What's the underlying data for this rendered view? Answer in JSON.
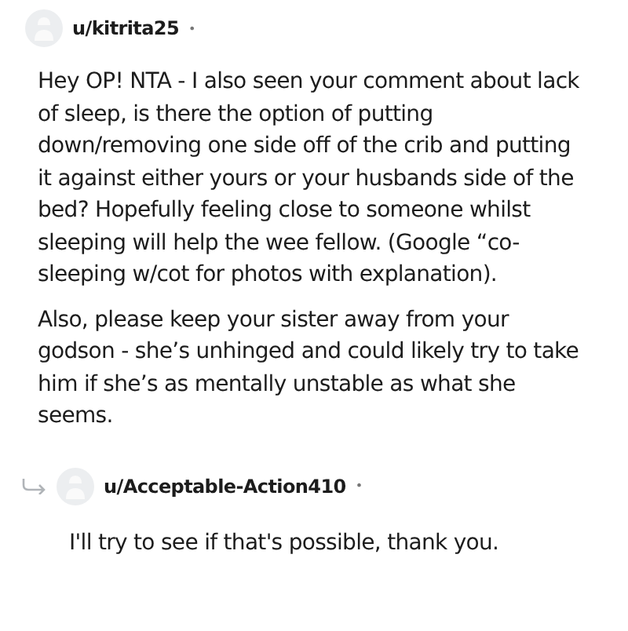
{
  "comments": [
    {
      "author": "u/kitrita25",
      "separator": "•",
      "reply": false,
      "paragraphs": [
        "Hey OP! NTA - I also seen your comment about lack of sleep, is there the option of putting down/removing one side off of the crib and putting it against either yours or your husbands side of the bed? Hopefully feeling close to someone whilst sleeping will help the wee fellow. (Google “co-sleeping w/cot for photos with explanation).",
        "Also, please keep your sister away from your godson - she’s unhinged and could likely try to take him if she’s as mentally unstable as what she seems."
      ]
    },
    {
      "author": "u/Acceptable-Action410",
      "separator": "•",
      "reply": true,
      "paragraphs": [
        "I'll try to see if that's possible, thank you."
      ]
    }
  ]
}
